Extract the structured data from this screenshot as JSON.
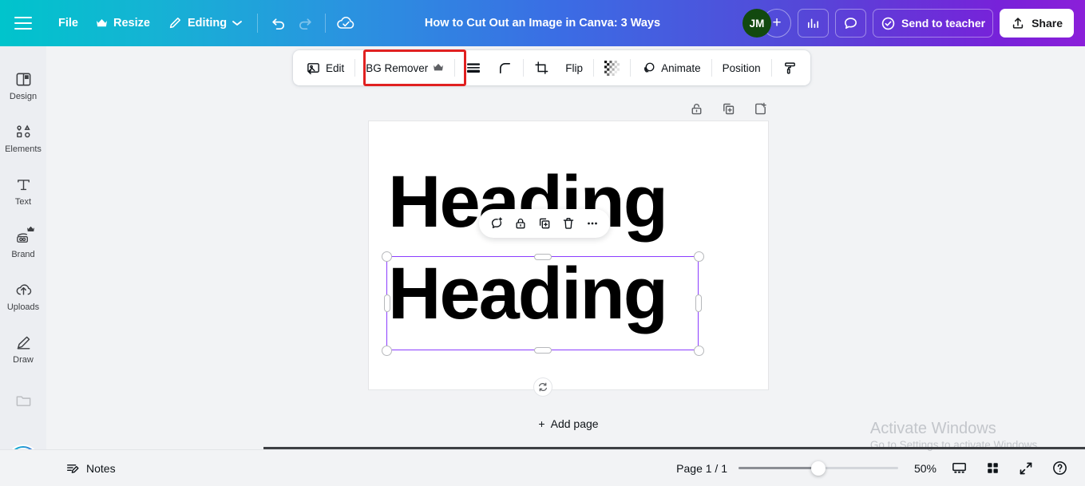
{
  "topbar": {
    "menu_icon": "hamburger-icon",
    "file_label": "File",
    "resize_label": "Resize",
    "resize_icon": "crown-icon",
    "editing_label": "Editing",
    "editing_icon": "pencil-icon",
    "editing_chevron": "chevron-down-icon",
    "undo_icon": "undo-arrow-icon",
    "redo_icon": "redo-arrow-icon",
    "cloud_icon": "cloud-check-icon",
    "doc_title": "How to Cut Out an Image in Canva: 3 Ways",
    "avatar_initials": "JM",
    "avatar_color": "#12490f",
    "add_person_label": "+",
    "insights_icon": "bar-chart-icon",
    "comment_icon": "speech-bubble-icon",
    "send_to_teacher_label": "Send to teacher",
    "send_to_teacher_icon": "check-circle-icon",
    "share_label": "Share",
    "share_icon": "upload-icon",
    "gradient_start": "#00c4cc",
    "gradient_end": "#8b1fd9"
  },
  "sidebar": {
    "items": [
      {
        "label": "Design",
        "icon": "layout-panel-icon",
        "crown": false
      },
      {
        "label": "Elements",
        "icon": "shapes-icon",
        "crown": false
      },
      {
        "label": "Text",
        "icon": "text-t-icon",
        "crown": false
      },
      {
        "label": "Brand",
        "icon": "brand-kit-icon",
        "crown": true
      },
      {
        "label": "Uploads",
        "icon": "cloud-upload-icon",
        "crown": false
      },
      {
        "label": "Draw",
        "icon": "pen-draw-icon",
        "crown": false
      },
      {
        "label": "",
        "icon": "folder-icon",
        "crown": false
      }
    ],
    "magic_button": "magic-sparkle-icon"
  },
  "toolbar": {
    "edit_label": "Edit",
    "edit_icon": "image-edit-icon",
    "bg_remover_label": "BG Remover",
    "bg_remover_crown": "crown-icon",
    "bg_remover_highlight_color": "#e02020",
    "lines_icon": "line-weight-icon",
    "corner_icon": "corner-radius-icon",
    "crop_icon": "crop-icon",
    "flip_label": "Flip",
    "transparency_icon": "transparency-checker-icon",
    "animate_label": "Animate",
    "animate_icon": "animate-circles-icon",
    "position_label": "Position",
    "paint_icon": "paint-roller-icon"
  },
  "canvas_tools": {
    "lock_icon": "lock-open-icon",
    "duplicate_icon": "duplicate-page-icon",
    "add_page_icon": "add-page-icon"
  },
  "canvas": {
    "heading_1": "Heading",
    "heading_2": "Heading",
    "selection_color": "#8b3dff",
    "rotate_icon": "rotate-icon",
    "add_page_label": "Add page",
    "add_page_plus": "+"
  },
  "context_menu": {
    "items": [
      {
        "icon": "comment-add-icon"
      },
      {
        "icon": "lock-icon"
      },
      {
        "icon": "duplicate-icon"
      },
      {
        "icon": "trash-icon"
      },
      {
        "icon": "more-dots-icon"
      }
    ]
  },
  "bottombar": {
    "notes_label": "Notes",
    "notes_icon": "notes-pencil-icon",
    "page_count": "Page 1 / 1",
    "zoom_value": "50%",
    "zoom_percent": 50,
    "presentation_icon": "presentation-view-icon",
    "grid_icon": "grid-view-icon",
    "fullscreen_icon": "fullscreen-expand-icon",
    "help_icon": "help-question-icon"
  },
  "watermark": {
    "line1": "Activate Windows",
    "line2": "Go to Settings to activate Windows."
  }
}
